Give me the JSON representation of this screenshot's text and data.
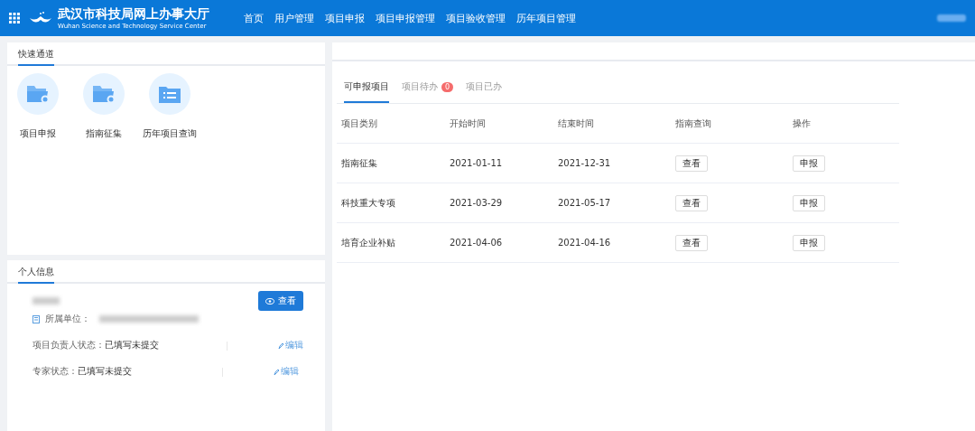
{
  "header": {
    "title": "武汉市科技局网上办事大厅",
    "subtitle": "Wuhan Science and Technology Service Center",
    "nav": [
      {
        "label": "首页"
      },
      {
        "label": "用户管理"
      },
      {
        "label": "项目申报"
      },
      {
        "label": "项目申报管理"
      },
      {
        "label": "项目验收管理"
      },
      {
        "label": "历年项目管理"
      }
    ]
  },
  "quick_access": {
    "title": "快速通道",
    "items": [
      {
        "label": "项目申报",
        "kind": "folder"
      },
      {
        "label": "指南征集",
        "kind": "folder"
      },
      {
        "label": "历年项目查询",
        "kind": "list"
      }
    ]
  },
  "personal_info": {
    "title": "个人信息",
    "view_button": "查看",
    "unit_label": "所属单位：",
    "statuses": [
      {
        "label": "项目负责人状态：",
        "value": "已填写未提交",
        "action": "编辑"
      },
      {
        "label": "专家状态：",
        "value": "已填写未提交",
        "action": "编辑"
      }
    ]
  },
  "projects": {
    "tabs": [
      {
        "label": "可申报项目",
        "selected": true
      },
      {
        "label": "项目待办",
        "selected": false,
        "badge": "0"
      },
      {
        "label": "项目已办",
        "selected": false
      }
    ],
    "columns": [
      "项目类别",
      "开始时间",
      "结束时间",
      "指南查询",
      "操作"
    ],
    "rows": [
      {
        "category": "指南征集",
        "start": "2021-01-11",
        "end": "2021-12-31",
        "guide": "查看",
        "action": "申报"
      },
      {
        "category": "科技重大专项",
        "start": "2021-03-29",
        "end": "2021-05-17",
        "guide": "查看",
        "action": "申报"
      },
      {
        "category": "培育企业补贴",
        "start": "2021-04-06",
        "end": "2021-04-16",
        "guide": "查看",
        "action": "申报"
      }
    ]
  }
}
